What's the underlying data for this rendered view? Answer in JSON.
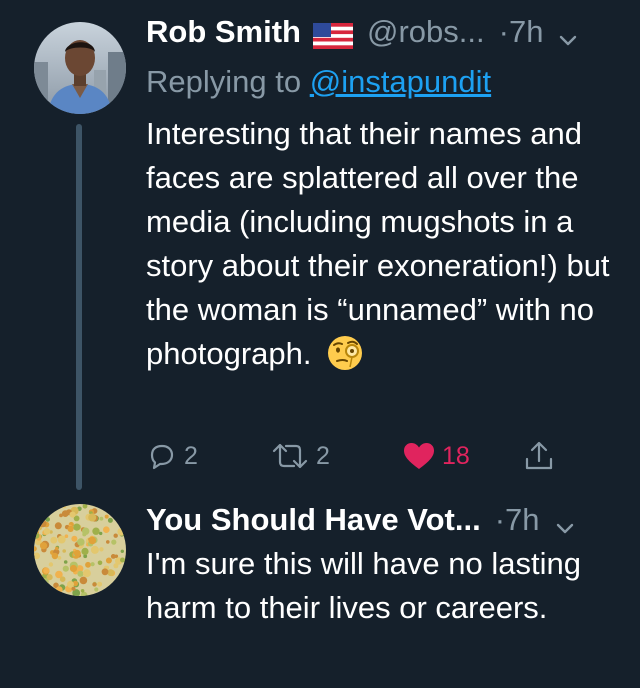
{
  "tweets": [
    {
      "display_name": "Rob Smith",
      "flag_icon": "us-flag-icon",
      "handle": "@robs...",
      "time": "·7h",
      "reply_prefix": "Replying to ",
      "reply_handle": "@instapundit",
      "body": "Interesting that their names and faces are splattered all over the media (including mugshots in a story about their exoneration!) but the woman is “unnamed” with no photograph.",
      "emoji": "face-with-monocle-emoji",
      "actions": {
        "replies": "2",
        "retweets": "2",
        "likes": "18",
        "liked": true
      }
    },
    {
      "display_name": "You Should Have Vot...",
      "handle": "",
      "time": "·7h",
      "body": "I'm sure this will have no lasting harm to their lives or careers."
    }
  ],
  "colors": {
    "background": "#15202b",
    "secondary_text": "#8899a6",
    "link": "#1da1f2",
    "like": "#e0245e",
    "thread_line": "#3d5466"
  }
}
